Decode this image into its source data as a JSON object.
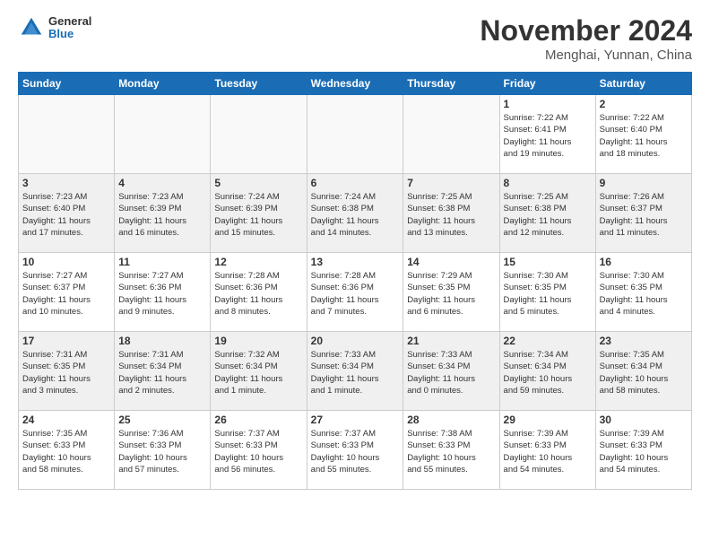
{
  "header": {
    "logo_text_general": "General",
    "logo_text_blue": "Blue",
    "month_title": "November 2024",
    "location": "Menghai, Yunnan, China"
  },
  "weekdays": [
    "Sunday",
    "Monday",
    "Tuesday",
    "Wednesday",
    "Thursday",
    "Friday",
    "Saturday"
  ],
  "weeks": [
    {
      "shaded": false,
      "days": [
        {
          "num": "",
          "info": "",
          "empty": true
        },
        {
          "num": "",
          "info": "",
          "empty": true
        },
        {
          "num": "",
          "info": "",
          "empty": true
        },
        {
          "num": "",
          "info": "",
          "empty": true
        },
        {
          "num": "",
          "info": "",
          "empty": true
        },
        {
          "num": "1",
          "info": "Sunrise: 7:22 AM\nSunset: 6:41 PM\nDaylight: 11 hours\nand 19 minutes.",
          "empty": false
        },
        {
          "num": "2",
          "info": "Sunrise: 7:22 AM\nSunset: 6:40 PM\nDaylight: 11 hours\nand 18 minutes.",
          "empty": false
        }
      ]
    },
    {
      "shaded": true,
      "days": [
        {
          "num": "3",
          "info": "Sunrise: 7:23 AM\nSunset: 6:40 PM\nDaylight: 11 hours\nand 17 minutes.",
          "empty": false
        },
        {
          "num": "4",
          "info": "Sunrise: 7:23 AM\nSunset: 6:39 PM\nDaylight: 11 hours\nand 16 minutes.",
          "empty": false
        },
        {
          "num": "5",
          "info": "Sunrise: 7:24 AM\nSunset: 6:39 PM\nDaylight: 11 hours\nand 15 minutes.",
          "empty": false
        },
        {
          "num": "6",
          "info": "Sunrise: 7:24 AM\nSunset: 6:38 PM\nDaylight: 11 hours\nand 14 minutes.",
          "empty": false
        },
        {
          "num": "7",
          "info": "Sunrise: 7:25 AM\nSunset: 6:38 PM\nDaylight: 11 hours\nand 13 minutes.",
          "empty": false
        },
        {
          "num": "8",
          "info": "Sunrise: 7:25 AM\nSunset: 6:38 PM\nDaylight: 11 hours\nand 12 minutes.",
          "empty": false
        },
        {
          "num": "9",
          "info": "Sunrise: 7:26 AM\nSunset: 6:37 PM\nDaylight: 11 hours\nand 11 minutes.",
          "empty": false
        }
      ]
    },
    {
      "shaded": false,
      "days": [
        {
          "num": "10",
          "info": "Sunrise: 7:27 AM\nSunset: 6:37 PM\nDaylight: 11 hours\nand 10 minutes.",
          "empty": false
        },
        {
          "num": "11",
          "info": "Sunrise: 7:27 AM\nSunset: 6:36 PM\nDaylight: 11 hours\nand 9 minutes.",
          "empty": false
        },
        {
          "num": "12",
          "info": "Sunrise: 7:28 AM\nSunset: 6:36 PM\nDaylight: 11 hours\nand 8 minutes.",
          "empty": false
        },
        {
          "num": "13",
          "info": "Sunrise: 7:28 AM\nSunset: 6:36 PM\nDaylight: 11 hours\nand 7 minutes.",
          "empty": false
        },
        {
          "num": "14",
          "info": "Sunrise: 7:29 AM\nSunset: 6:35 PM\nDaylight: 11 hours\nand 6 minutes.",
          "empty": false
        },
        {
          "num": "15",
          "info": "Sunrise: 7:30 AM\nSunset: 6:35 PM\nDaylight: 11 hours\nand 5 minutes.",
          "empty": false
        },
        {
          "num": "16",
          "info": "Sunrise: 7:30 AM\nSunset: 6:35 PM\nDaylight: 11 hours\nand 4 minutes.",
          "empty": false
        }
      ]
    },
    {
      "shaded": true,
      "days": [
        {
          "num": "17",
          "info": "Sunrise: 7:31 AM\nSunset: 6:35 PM\nDaylight: 11 hours\nand 3 minutes.",
          "empty": false
        },
        {
          "num": "18",
          "info": "Sunrise: 7:31 AM\nSunset: 6:34 PM\nDaylight: 11 hours\nand 2 minutes.",
          "empty": false
        },
        {
          "num": "19",
          "info": "Sunrise: 7:32 AM\nSunset: 6:34 PM\nDaylight: 11 hours\nand 1 minute.",
          "empty": false
        },
        {
          "num": "20",
          "info": "Sunrise: 7:33 AM\nSunset: 6:34 PM\nDaylight: 11 hours\nand 1 minute.",
          "empty": false
        },
        {
          "num": "21",
          "info": "Sunrise: 7:33 AM\nSunset: 6:34 PM\nDaylight: 11 hours\nand 0 minutes.",
          "empty": false
        },
        {
          "num": "22",
          "info": "Sunrise: 7:34 AM\nSunset: 6:34 PM\nDaylight: 10 hours\nand 59 minutes.",
          "empty": false
        },
        {
          "num": "23",
          "info": "Sunrise: 7:35 AM\nSunset: 6:34 PM\nDaylight: 10 hours\nand 58 minutes.",
          "empty": false
        }
      ]
    },
    {
      "shaded": false,
      "days": [
        {
          "num": "24",
          "info": "Sunrise: 7:35 AM\nSunset: 6:33 PM\nDaylight: 10 hours\nand 58 minutes.",
          "empty": false
        },
        {
          "num": "25",
          "info": "Sunrise: 7:36 AM\nSunset: 6:33 PM\nDaylight: 10 hours\nand 57 minutes.",
          "empty": false
        },
        {
          "num": "26",
          "info": "Sunrise: 7:37 AM\nSunset: 6:33 PM\nDaylight: 10 hours\nand 56 minutes.",
          "empty": false
        },
        {
          "num": "27",
          "info": "Sunrise: 7:37 AM\nSunset: 6:33 PM\nDaylight: 10 hours\nand 55 minutes.",
          "empty": false
        },
        {
          "num": "28",
          "info": "Sunrise: 7:38 AM\nSunset: 6:33 PM\nDaylight: 10 hours\nand 55 minutes.",
          "empty": false
        },
        {
          "num": "29",
          "info": "Sunrise: 7:39 AM\nSunset: 6:33 PM\nDaylight: 10 hours\nand 54 minutes.",
          "empty": false
        },
        {
          "num": "30",
          "info": "Sunrise: 7:39 AM\nSunset: 6:33 PM\nDaylight: 10 hours\nand 54 minutes.",
          "empty": false
        }
      ]
    }
  ]
}
